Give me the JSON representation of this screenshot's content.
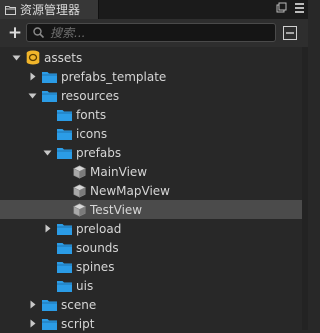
{
  "panel": {
    "title": "资源管理器"
  },
  "toolbar": {
    "add_label": "+",
    "search_placeholder": "搜索...",
    "search_value": ""
  },
  "colors": {
    "folder": "#2b9ce6",
    "asset_db": "#f1b52a",
    "selected_row": "#4b4b4b"
  },
  "tree": {
    "rows": [
      {
        "label": "assets",
        "icon": "asset-db-icon",
        "expanded": true
      },
      {
        "label": "prefabs_template",
        "icon": "folder-icon",
        "expanded": false
      },
      {
        "label": "resources",
        "icon": "folder-icon",
        "expanded": true
      },
      {
        "label": "fonts",
        "icon": "folder-icon"
      },
      {
        "label": "icons",
        "icon": "folder-icon"
      },
      {
        "label": "prefabs",
        "icon": "folder-icon",
        "expanded": true
      },
      {
        "label": "MainView",
        "icon": "prefab-icon"
      },
      {
        "label": "NewMapView",
        "icon": "prefab-icon"
      },
      {
        "label": "TestView",
        "icon": "prefab-icon",
        "selected": true
      },
      {
        "label": "preload",
        "icon": "folder-icon",
        "expanded": false
      },
      {
        "label": "sounds",
        "icon": "folder-icon"
      },
      {
        "label": "spines",
        "icon": "folder-icon"
      },
      {
        "label": "uis",
        "icon": "folder-icon"
      },
      {
        "label": "scene",
        "icon": "folder-icon",
        "expanded": false
      },
      {
        "label": "script",
        "icon": "folder-icon",
        "expanded": false
      }
    ]
  }
}
